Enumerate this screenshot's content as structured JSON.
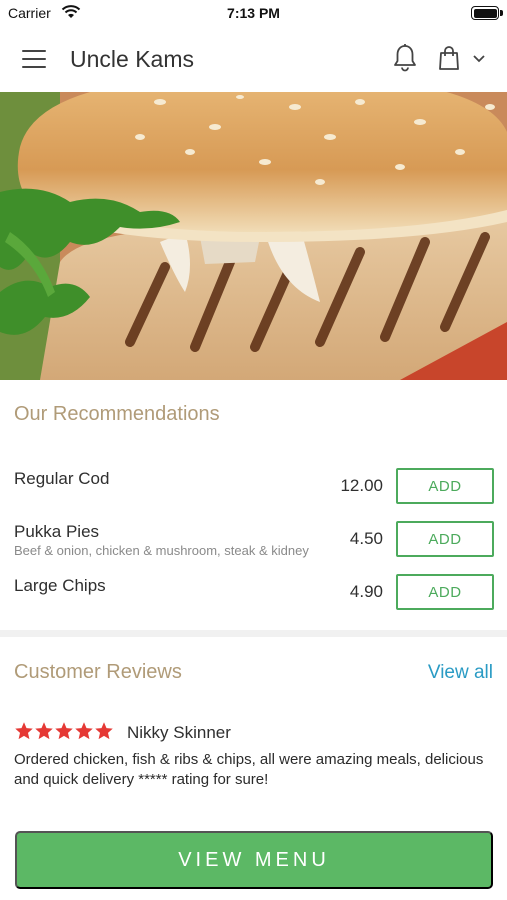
{
  "status_bar": {
    "carrier": "Carrier",
    "time": "7:13 PM"
  },
  "header": {
    "title": "Uncle Kams"
  },
  "recommendations": {
    "title": "Our Recommendations",
    "items": [
      {
        "name": "Regular Cod",
        "description": "",
        "price": "12.00",
        "button": "ADD"
      },
      {
        "name": "Pukka Pies",
        "description": "Beef & onion, chicken & mushroom, steak & kidney",
        "price": "4.50",
        "button": "ADD"
      },
      {
        "name": "Large Chips",
        "description": "",
        "price": "4.90",
        "button": "ADD"
      }
    ]
  },
  "reviews": {
    "title": "Customer Reviews",
    "view_all": "View all",
    "items": [
      {
        "rating": 5,
        "name": "Nikky Skinner",
        "text": "Ordered chicken, fish & ribs & chips, all were amazing meals, delicious and quick delivery ***** rating for sure!"
      }
    ]
  },
  "cta": {
    "label": "VIEW MENU"
  },
  "colors": {
    "accent_green": "#5cb865",
    "section_title": "#b09b78",
    "link_blue": "#2a9bc4",
    "star_red": "#e53935"
  },
  "icons": [
    "wifi-icon",
    "battery-icon",
    "menu-icon",
    "bell-icon",
    "shopping-bag-icon",
    "chevron-down-icon",
    "star-icon"
  ]
}
